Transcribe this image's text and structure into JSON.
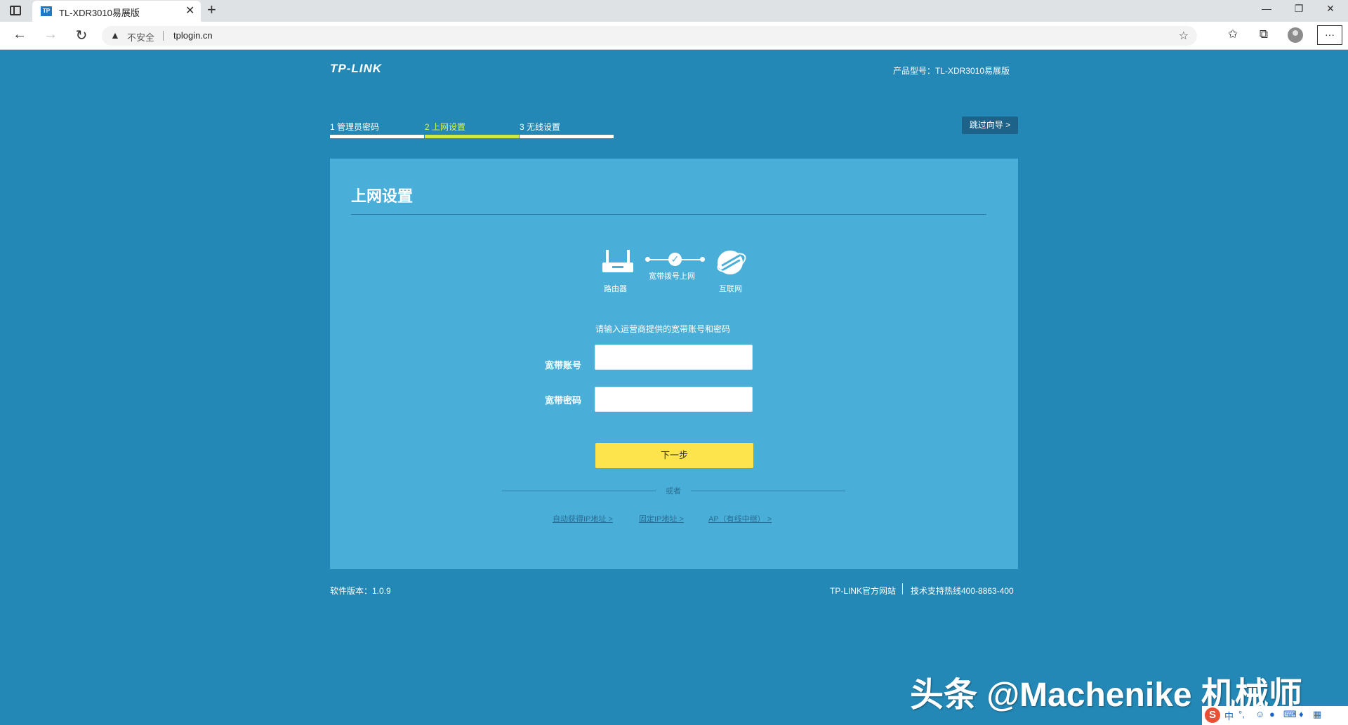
{
  "browser": {
    "tab_title": "TL-XDR3010易展版",
    "tab_favicon": "TP",
    "tab_close": "✕",
    "new_tab": "+",
    "insecure_label": "不安全",
    "url": "tplogin.cn",
    "window_controls": {
      "minimize": "—",
      "restore": "❐",
      "close": "✕"
    },
    "more_label": "···"
  },
  "header": {
    "logo": "TP-LINK",
    "model": "产品型号：TL-XDR3010易展版"
  },
  "steps": [
    {
      "label": "1 管理员密码",
      "active": false
    },
    {
      "label": "2 上网设置",
      "active": true
    },
    {
      "label": "3 无线设置",
      "active": false
    }
  ],
  "skip_label": "跳过向导 >",
  "panel": {
    "title": "上网设置",
    "diagram": {
      "router_label": "路由器",
      "connection_label": "宽带拨号上网",
      "internet_label": "互联网"
    },
    "prompt": "请输入运营商提供的宽带账号和密码",
    "account_label": "宽带账号",
    "account_value": "",
    "password_label": "宽带密码",
    "password_value": "",
    "next_label": "下一步",
    "or_label": "或者",
    "links": [
      "自动获得IP地址 >",
      "固定IP地址 >",
      "AP（有线中继） >"
    ]
  },
  "footer": {
    "version": "软件版本：1.0.9",
    "website": "TP-LINK官方网站",
    "hotline": "技术支持热线400-8863-400"
  },
  "watermark": "头条 @Machenike 机械师",
  "ime": {
    "logo": "S",
    "mode": "中",
    "punct": "°,"
  }
}
